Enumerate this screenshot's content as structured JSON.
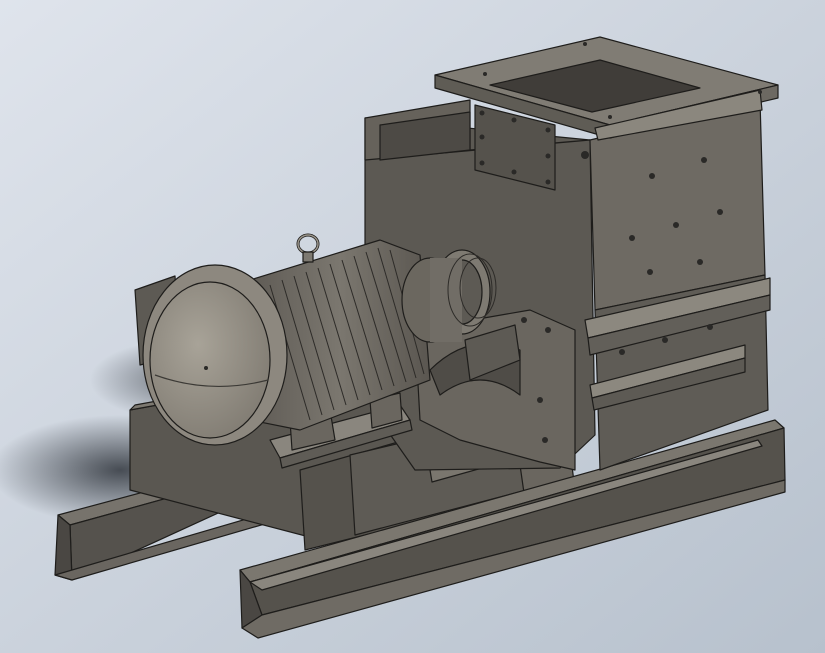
{
  "scene": {
    "subject": "hammer-mill-assembly",
    "background_gradient": [
      "#d9dfe8",
      "#b9c3cf"
    ],
    "colors": {
      "steel_dark": "#4e4b46",
      "steel_mid": "#6d6a64",
      "steel_light": "#8a867e",
      "motor_body": "#6f6b64",
      "motor_cap": "#9b968c",
      "edge": "#1e1d1b",
      "shadow": "#3a3f47"
    },
    "parts": [
      "feed-hopper",
      "inspection-cover-plate",
      "mill-housing",
      "electric-motor",
      "motor-fan-cover",
      "motor-lifting-eye",
      "shaft-coupling",
      "bearing-support-plate",
      "base-frame",
      "front-channel-beam",
      "rear-channel-beam"
    ]
  }
}
